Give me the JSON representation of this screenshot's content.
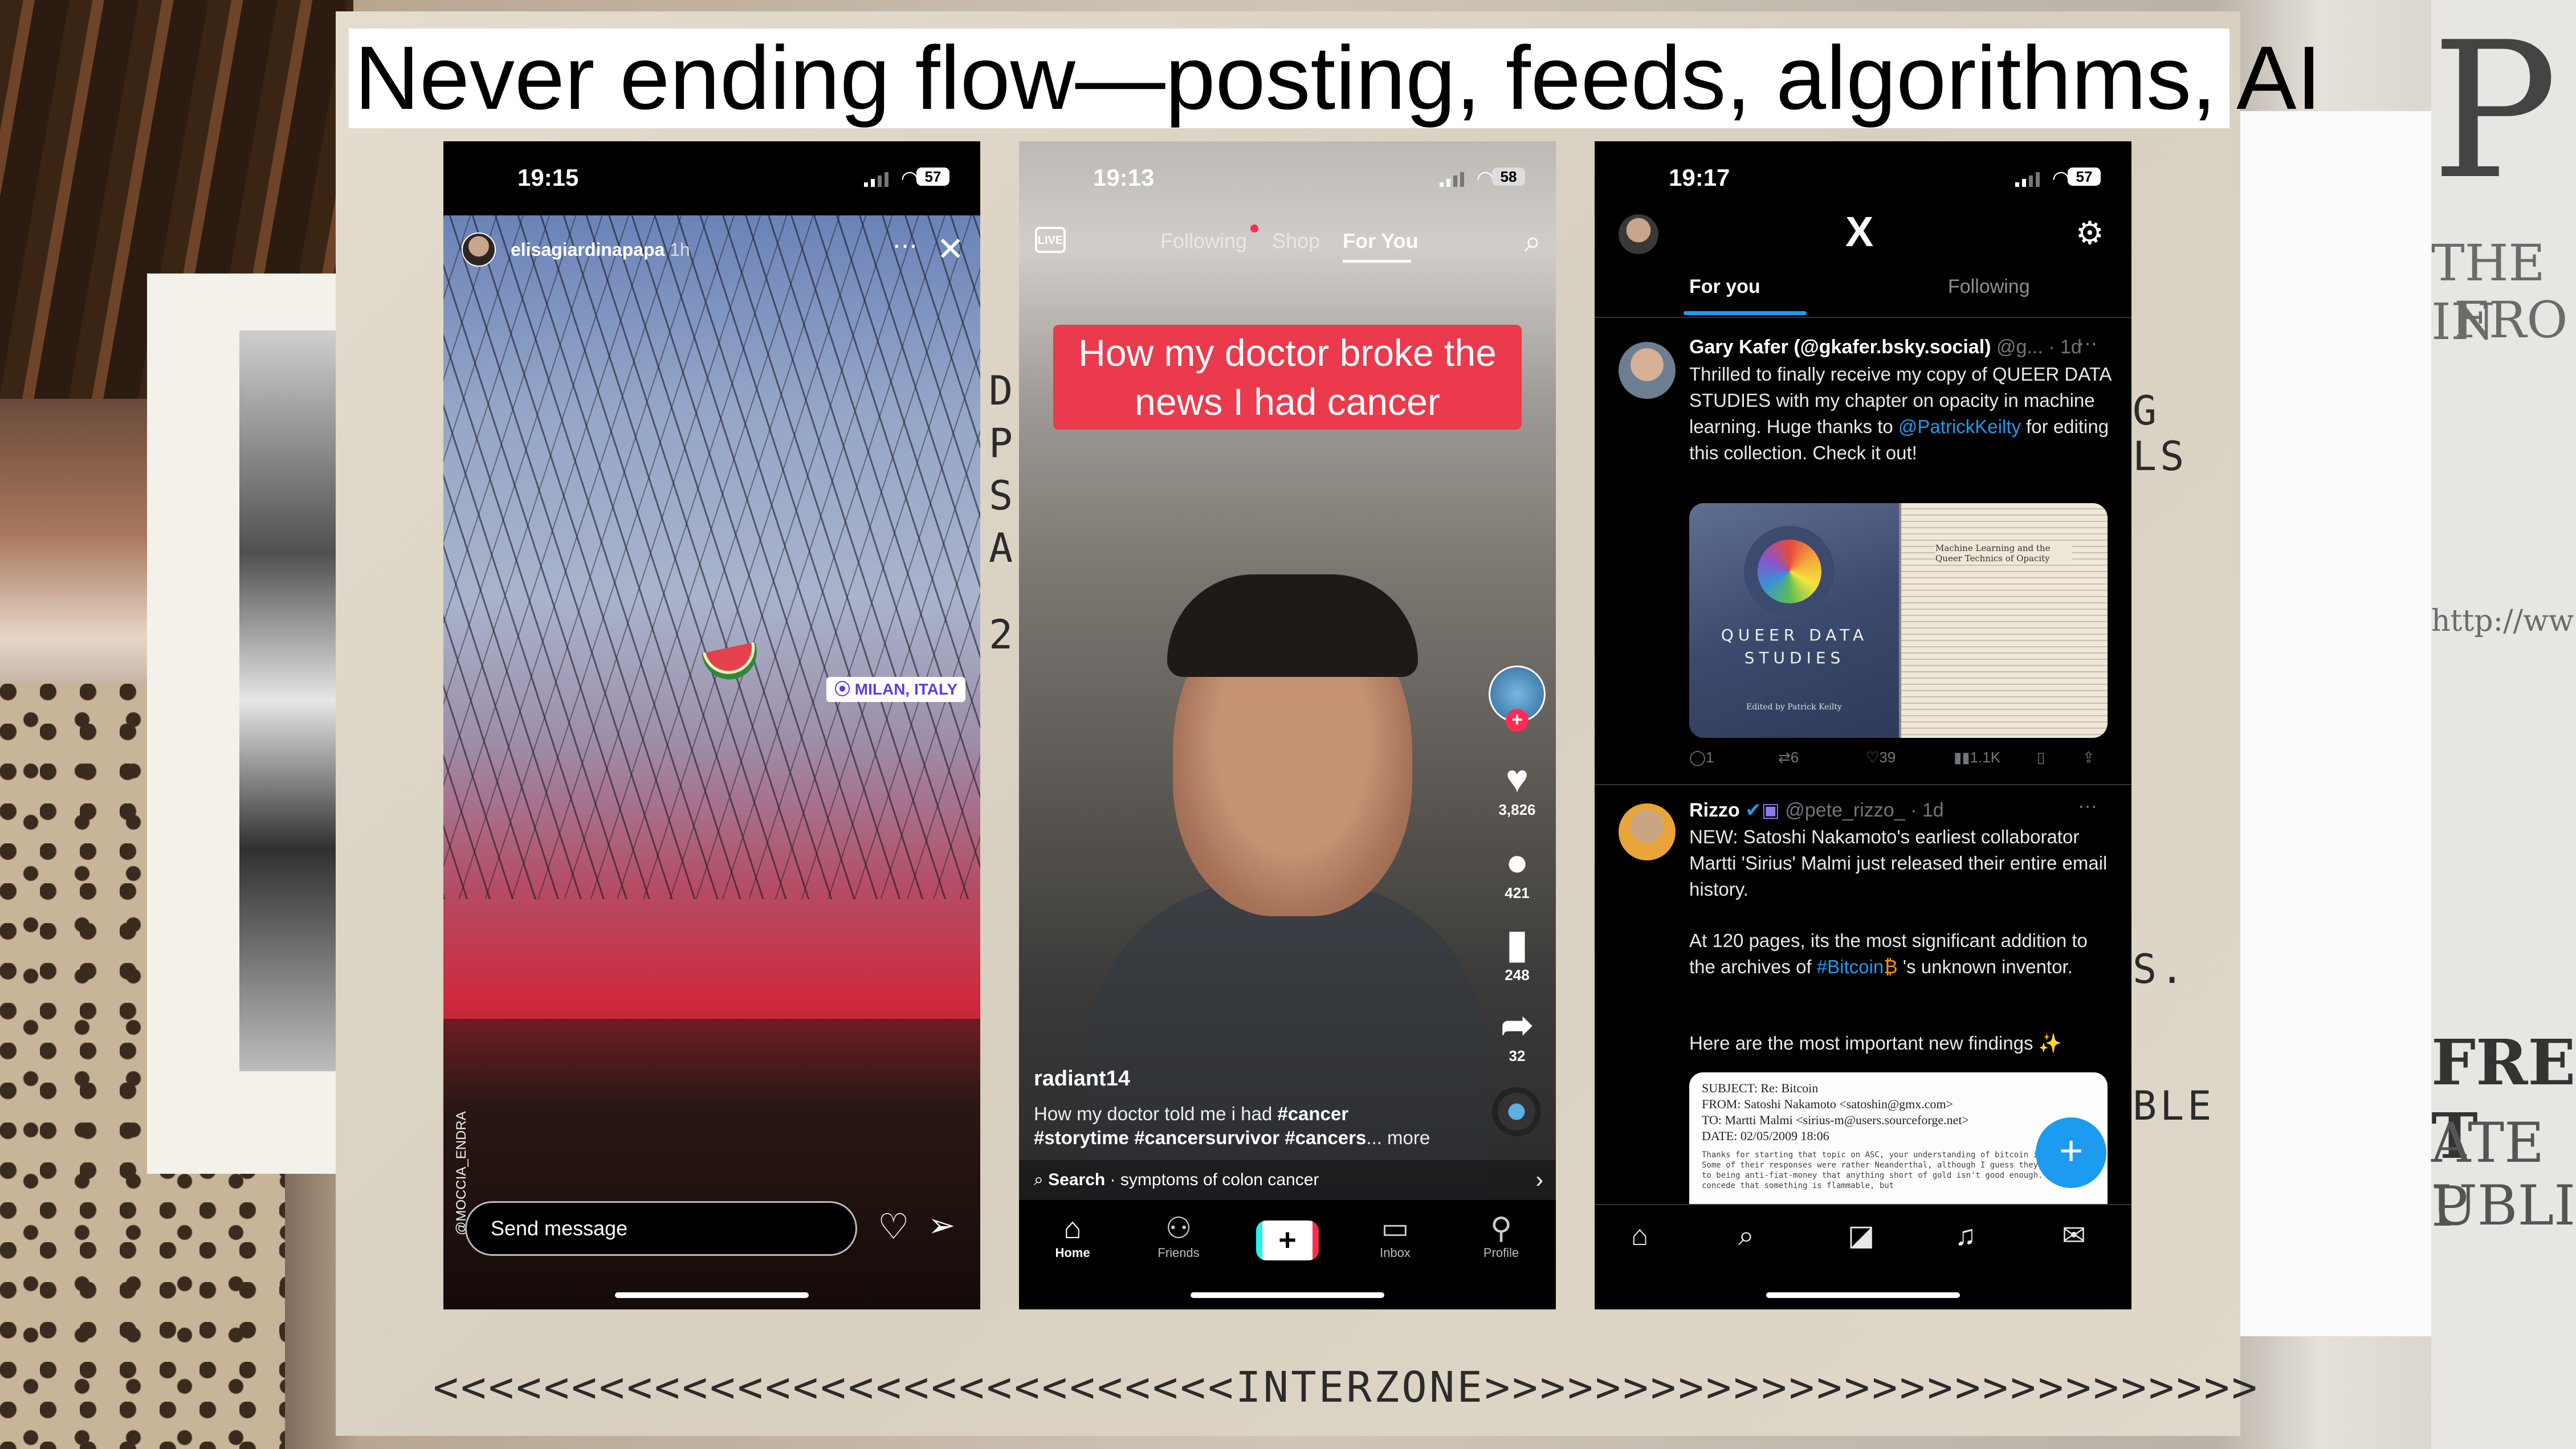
{
  "slide": {
    "title": "Never ending flow—posting, feeds, algorithms, AI",
    "footer": "<<<<<<<<<<<<<<<<<<<<<<<<<<<<<INTERZONE>>>>>>>>>>>>>>>>>>>>>>>>>>>>"
  },
  "background": {
    "poster_lines": [
      "THE IN",
      "FRO",
      "http://ww",
      "FREE T",
      "ATE P",
      "UBLIC"
    ],
    "typewriter_left": [
      "D",
      "P",
      "S",
      "A",
      "2"
    ],
    "typewriter_marks": [
      "G",
      "LS",
      "S.",
      "BLE"
    ]
  },
  "phone1": {
    "status": {
      "time": "19:15",
      "battery": "57"
    },
    "username": "elisagiardinapapa",
    "age": "1h",
    "more_icon": "more-dots-icon",
    "close_icon": "close-icon",
    "location_sticker": "MILAN, ITALY",
    "photo_credit": "@MOCCIA_ENDRA",
    "message_placeholder": "Send message",
    "heart_icon": "heart-outline-icon",
    "send_icon": "paper-plane-icon"
  },
  "phone2": {
    "status": {
      "time": "19:13",
      "battery": "58"
    },
    "live_label": "LIVE",
    "tabs": [
      "Following",
      "Shop",
      "For You"
    ],
    "active_tab": "For You",
    "caption": "How my doctor broke the news I had cancer",
    "likes": "3,826",
    "comments": "421",
    "saves": "248",
    "shares": "32",
    "username": "radiant14",
    "description_text": "How my doctor told me i had ",
    "description_tags_1": "#cancer",
    "description_tags_2": "#storytime #cancersurvivor #cancers",
    "description_more": "... more",
    "search_label": "Search",
    "search_query": "symptoms of colon cancer",
    "nav": [
      "Home",
      "Friends",
      "",
      "Inbox",
      "Profile"
    ],
    "create_label": "+"
  },
  "phone3": {
    "status": {
      "time": "19:17",
      "battery": "57"
    },
    "logo": "X",
    "tabs": [
      "For you",
      "Following"
    ],
    "active_tab": "For you",
    "tweet1": {
      "name": "Gary Kafer (@gkafer.bsky.social)",
      "handle": "@g... · 1d",
      "text_pre": "Thrilled to finally receive my copy of QUEER DATA STUDIES with my chapter on opacity in machine learning. Huge thanks to ",
      "mention": "@PatrickKeilty",
      "text_post": " for editing this collection. Check it out!",
      "book_title": "QUEER DATA STUDIES",
      "book_editor": "Edited by Patrick Keilty",
      "page_heading": "Machine Learning and the Queer Technics of Opacity",
      "replies": "1",
      "reposts": "6",
      "likes": "39",
      "views": "1.1K"
    },
    "tweet2": {
      "name": "Rizzo",
      "handle": "@pete_rizzo_ · 1d",
      "text1": "NEW: Satoshi Nakamoto's earliest collaborator Martti 'Sirius' Malmi just released their entire email history.",
      "text2_pre": "At 120 pages, its the most significant addition to the archives of ",
      "hashtag": "#Bitcoin",
      "text2_post": " 's unknown inventor.",
      "text3": "Here are the most important new findings ✨",
      "card_subject": "SUBJECT: Re: Bitcoin",
      "card_from": "FROM: Satoshi Nakamoto <satoshin@gmx.com>",
      "card_to": "TO: Martti Malmi <sirius-m@users.sourceforge.net>",
      "card_date": "DATE: 02/05/2009 18:06",
      "card_body": "Thanks for starting that topic on ASC, your understanding of bitcoin is spot on. Some of their responses were rather Neanderthal, although I guess they're so used to being anti-fiat-money that anything short of gold isn't good enough. They concede that something is flammable, but"
    },
    "fab_label": "+",
    "nav_icons": [
      "home-icon",
      "search-icon",
      "grok-icon",
      "bell-icon",
      "mail-icon"
    ]
  },
  "colors": {
    "tiktok_caption": "#ea3a4c",
    "x_blue": "#1d9bf0",
    "tiktok_red": "#fe2c55"
  }
}
